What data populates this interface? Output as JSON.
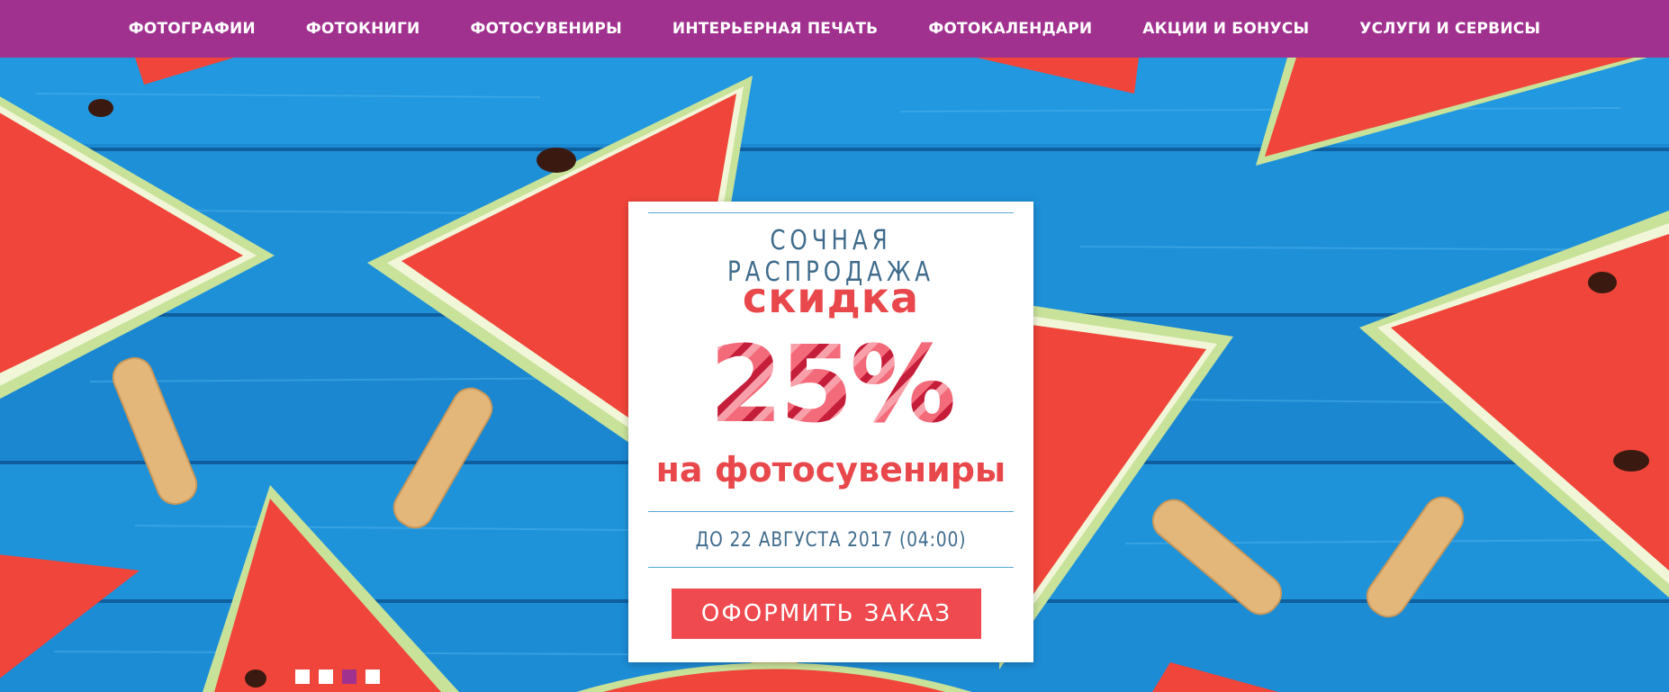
{
  "nav": {
    "items": [
      {
        "label": "ФОТОГРАФИИ"
      },
      {
        "label": "ФОТОКНИГИ"
      },
      {
        "label": "ФОТОСУВЕНИРЫ"
      },
      {
        "label": "ИНТЕРЬЕРНАЯ ПЕЧАТЬ"
      },
      {
        "label": "ФОТОКАЛЕНДАРИ"
      },
      {
        "label": "АКЦИИ И БОНУСЫ"
      },
      {
        "label": "УСЛУГИ И СЕРВИСЫ"
      }
    ]
  },
  "promo": {
    "title": "СОЧНАЯ  РАСПРОДАЖА",
    "discount_label": "скидка",
    "discount_value": "25%",
    "discount_target": "на фотосувениры",
    "deadline": "ДО 22 АВГУСТА 2017 (04:00)",
    "button_label": "ОФОРМИТЬ ЗАКАЗ"
  },
  "slider": {
    "slide_count": 4,
    "active_index": 2
  },
  "colors": {
    "nav_bg": "#a1318f",
    "accent_red": "#ef4a4f",
    "board_blue": "#1d8fd6",
    "text_blue": "#3f6c8c"
  }
}
